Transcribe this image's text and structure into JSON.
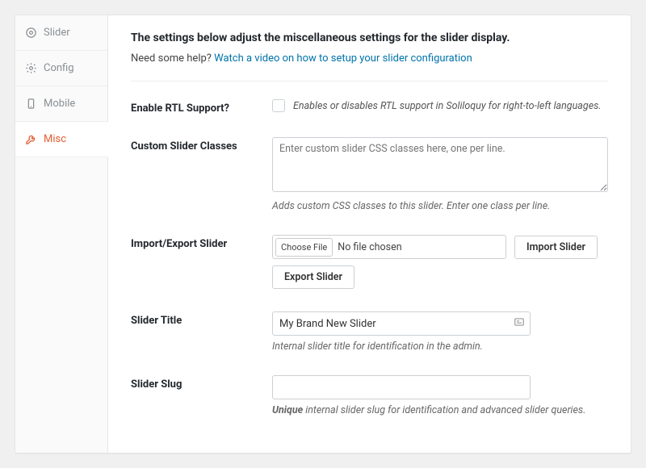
{
  "tabs": {
    "slider": "Slider",
    "config": "Config",
    "mobile": "Mobile",
    "misc": "Misc"
  },
  "header": {
    "title": "The settings below adjust the miscellaneous settings for the slider display.",
    "help_prefix": "Need some help? ",
    "help_link": "Watch a video on how to setup your slider configuration"
  },
  "fields": {
    "rtl": {
      "label": "Enable RTL Support?",
      "desc": "Enables or disables RTL support in Soliloquy for right-to-left languages."
    },
    "classes": {
      "label": "Custom Slider Classes",
      "placeholder": "Enter custom slider CSS classes here, one per line.",
      "desc": "Adds custom CSS classes to this slider. Enter one class per line."
    },
    "importexport": {
      "label": "Import/Export Slider",
      "choose": "Choose File",
      "nofile": "No file chosen",
      "import": "Import Slider",
      "export": "Export Slider"
    },
    "title": {
      "label": "Slider Title",
      "value": "My Brand New Slider",
      "desc": "Internal slider title for identification in the admin."
    },
    "slug": {
      "label": "Slider Slug",
      "value": "",
      "desc_strong": "Unique",
      "desc_rest": " internal slider slug for identification and advanced slider queries."
    }
  }
}
